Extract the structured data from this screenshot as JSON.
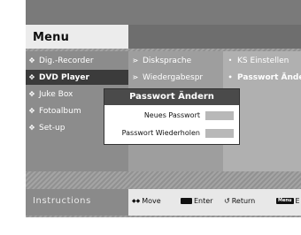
{
  "header": {
    "title": "Menu"
  },
  "main_menu": [
    {
      "label": "Dig.-Recorder",
      "bullet": "✥"
    },
    {
      "label": "DVD Player",
      "bullet": "✥"
    },
    {
      "label": "Juke Box",
      "bullet": "✥"
    },
    {
      "label": "Fotoalbum",
      "bullet": "✥"
    },
    {
      "label": "Set-up",
      "bullet": "✥"
    }
  ],
  "sub_menu": [
    {
      "label": "Disksprache",
      "bullet": "⋗"
    },
    {
      "label": "Wiedergabespr",
      "bullet": "⋗"
    }
  ],
  "sub_sub_menu": [
    {
      "label": "KS Einstellen",
      "bullet": "•"
    },
    {
      "label": "Passwort Ände",
      "bullet": "•"
    }
  ],
  "dialog": {
    "title": "Passwort Ändern",
    "new_password_label": "Neues Passwort",
    "repeat_password_label": "Passwort Wiederholen"
  },
  "instructions": {
    "label": "Instructions",
    "move_icon": "◆◆",
    "move": "Move",
    "enter": "Enter",
    "return_icon": "↺",
    "return": "Return",
    "menu_key": "Menu",
    "menu_suffix": "E"
  },
  "colors": {
    "selected_row": "#3b3b3b",
    "dialog_title_bg": "#4a4a4a"
  }
}
